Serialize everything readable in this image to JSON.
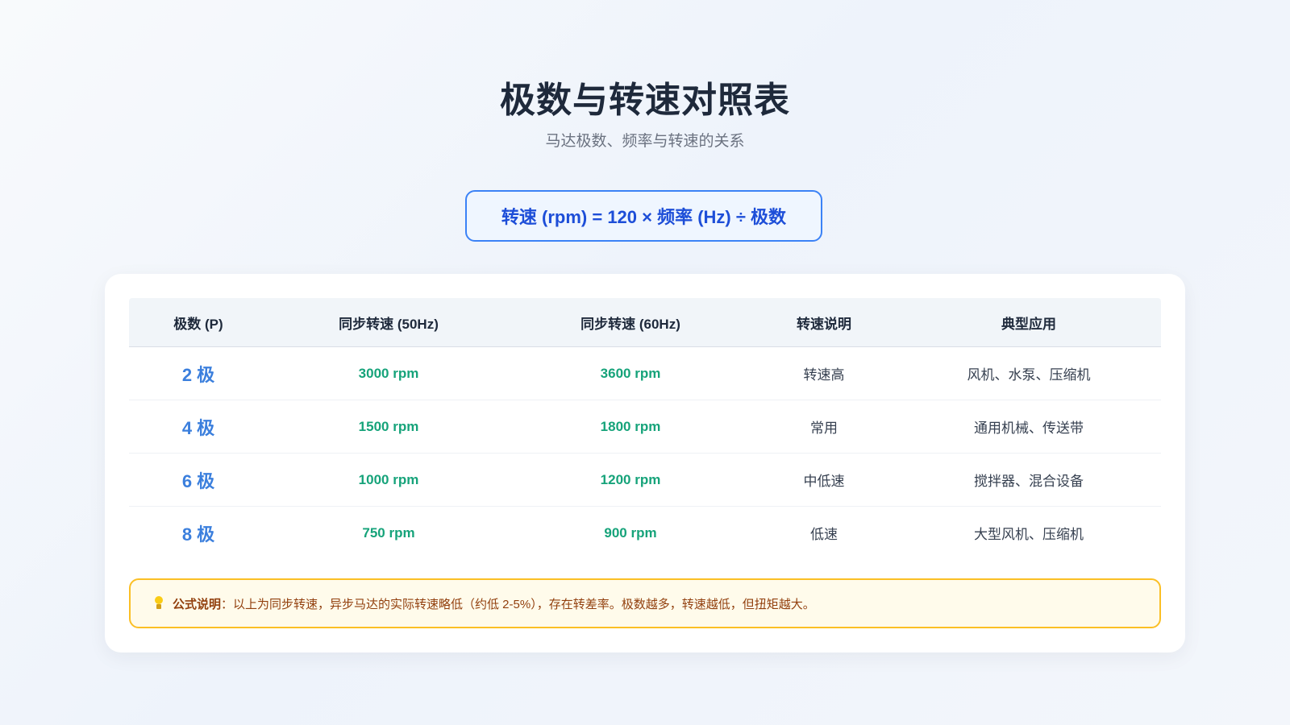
{
  "header": {
    "title": "极数与转速对照表",
    "subtitle": "马达极数、频率与转速的关系"
  },
  "formula": {
    "text": "转速 (rpm) = 120 × 频率 (Hz) ÷ 极数"
  },
  "table": {
    "columns": [
      "极数 (P)",
      "同步转速 (50Hz)",
      "同步转速 (60Hz)",
      "转速说明",
      "典型应用"
    ],
    "rows": [
      {
        "pole": "2 极",
        "speed_50": "3000 rpm",
        "speed_60": "3600 rpm",
        "desc": "转速高",
        "app": "风机、水泵、压缩机"
      },
      {
        "pole": "4 极",
        "speed_50": "1500 rpm",
        "speed_60": "1800 rpm",
        "desc": "常用",
        "app": "通用机械、传送带"
      },
      {
        "pole": "6 极",
        "speed_50": "1000 rpm",
        "speed_60": "1200 rpm",
        "desc": "中低速",
        "app": "搅拌器、混合设备"
      },
      {
        "pole": "8 极",
        "speed_50": "750 rpm",
        "speed_60": "900 rpm",
        "desc": "低速",
        "app": "大型风机、压缩机"
      }
    ]
  },
  "note": {
    "icon": "lightbulb-icon",
    "label": "公式说明",
    "text": "：以上为同步转速，异步马达的实际转速略低（约低 2-5%），存在转差率。极数越多，转速越低，但扭矩越大。"
  },
  "colors": {
    "pole": "#3b7fdd",
    "speed": "#16a37a",
    "formula_border": "#3b82f6",
    "note_border": "#fbbf24"
  }
}
